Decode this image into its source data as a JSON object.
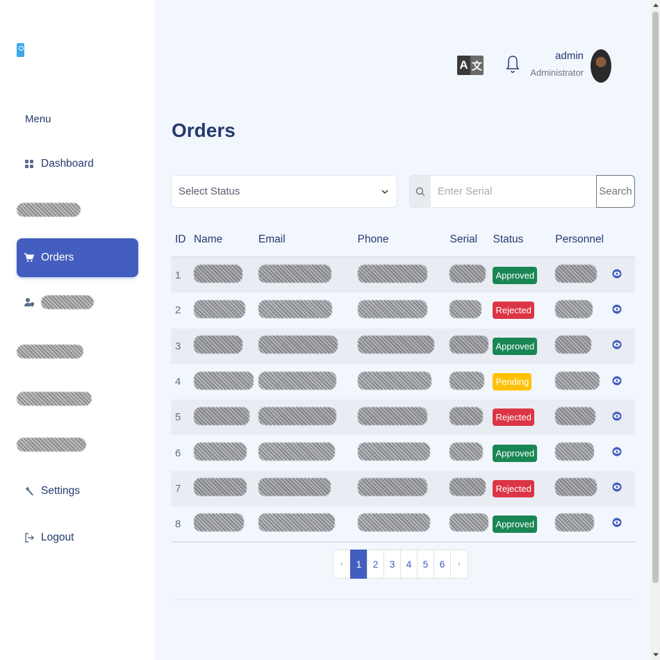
{
  "sidebar": {
    "menu_title": "Menu",
    "items": [
      {
        "label": "Dashboard",
        "icon": "grid-icon"
      },
      {
        "label": "",
        "icon": "redacted"
      },
      {
        "label": "Orders",
        "icon": "cart-icon",
        "active": true
      },
      {
        "label": "",
        "icon": "user-shield-icon"
      },
      {
        "label": "",
        "icon": "redacted"
      },
      {
        "label": "",
        "icon": "redacted"
      },
      {
        "label": "",
        "icon": "redacted"
      },
      {
        "label": "Settings",
        "icon": "wrench-icon"
      },
      {
        "label": "Logout",
        "icon": "logout-icon"
      }
    ]
  },
  "header": {
    "user_name": "admin",
    "user_role": "Administrator",
    "lang_icon": "translate-icon",
    "bell_icon": "bell-icon"
  },
  "main": {
    "title": "Orders",
    "status_select": {
      "value": "Select Status"
    },
    "search": {
      "placeholder": "Enter Serial",
      "button": "Search"
    }
  },
  "table": {
    "columns": [
      "ID",
      "Name",
      "Email",
      "Phone",
      "Serial",
      "Status",
      "Personnel"
    ],
    "rows": [
      {
        "id": "1",
        "status": "Approved",
        "status_kind": "approved"
      },
      {
        "id": "2",
        "status": "Rejected",
        "status_kind": "rejected"
      },
      {
        "id": "3",
        "status": "Approved",
        "status_kind": "approved"
      },
      {
        "id": "4",
        "status": "Pending",
        "status_kind": "pending"
      },
      {
        "id": "5",
        "status": "Rejected",
        "status_kind": "rejected"
      },
      {
        "id": "6",
        "status": "Approved",
        "status_kind": "approved"
      },
      {
        "id": "7",
        "status": "Rejected",
        "status_kind": "rejected"
      },
      {
        "id": "8",
        "status": "Approved",
        "status_kind": "approved"
      }
    ]
  },
  "pagination": {
    "prev": "‹",
    "next": "›",
    "pages": [
      "1",
      "2",
      "3",
      "4",
      "5",
      "6"
    ],
    "current": "1"
  },
  "colors": {
    "accent": "#435ebe",
    "approved": "#198754",
    "rejected": "#dc3545",
    "pending": "#ffc107",
    "heading": "#25396f"
  }
}
